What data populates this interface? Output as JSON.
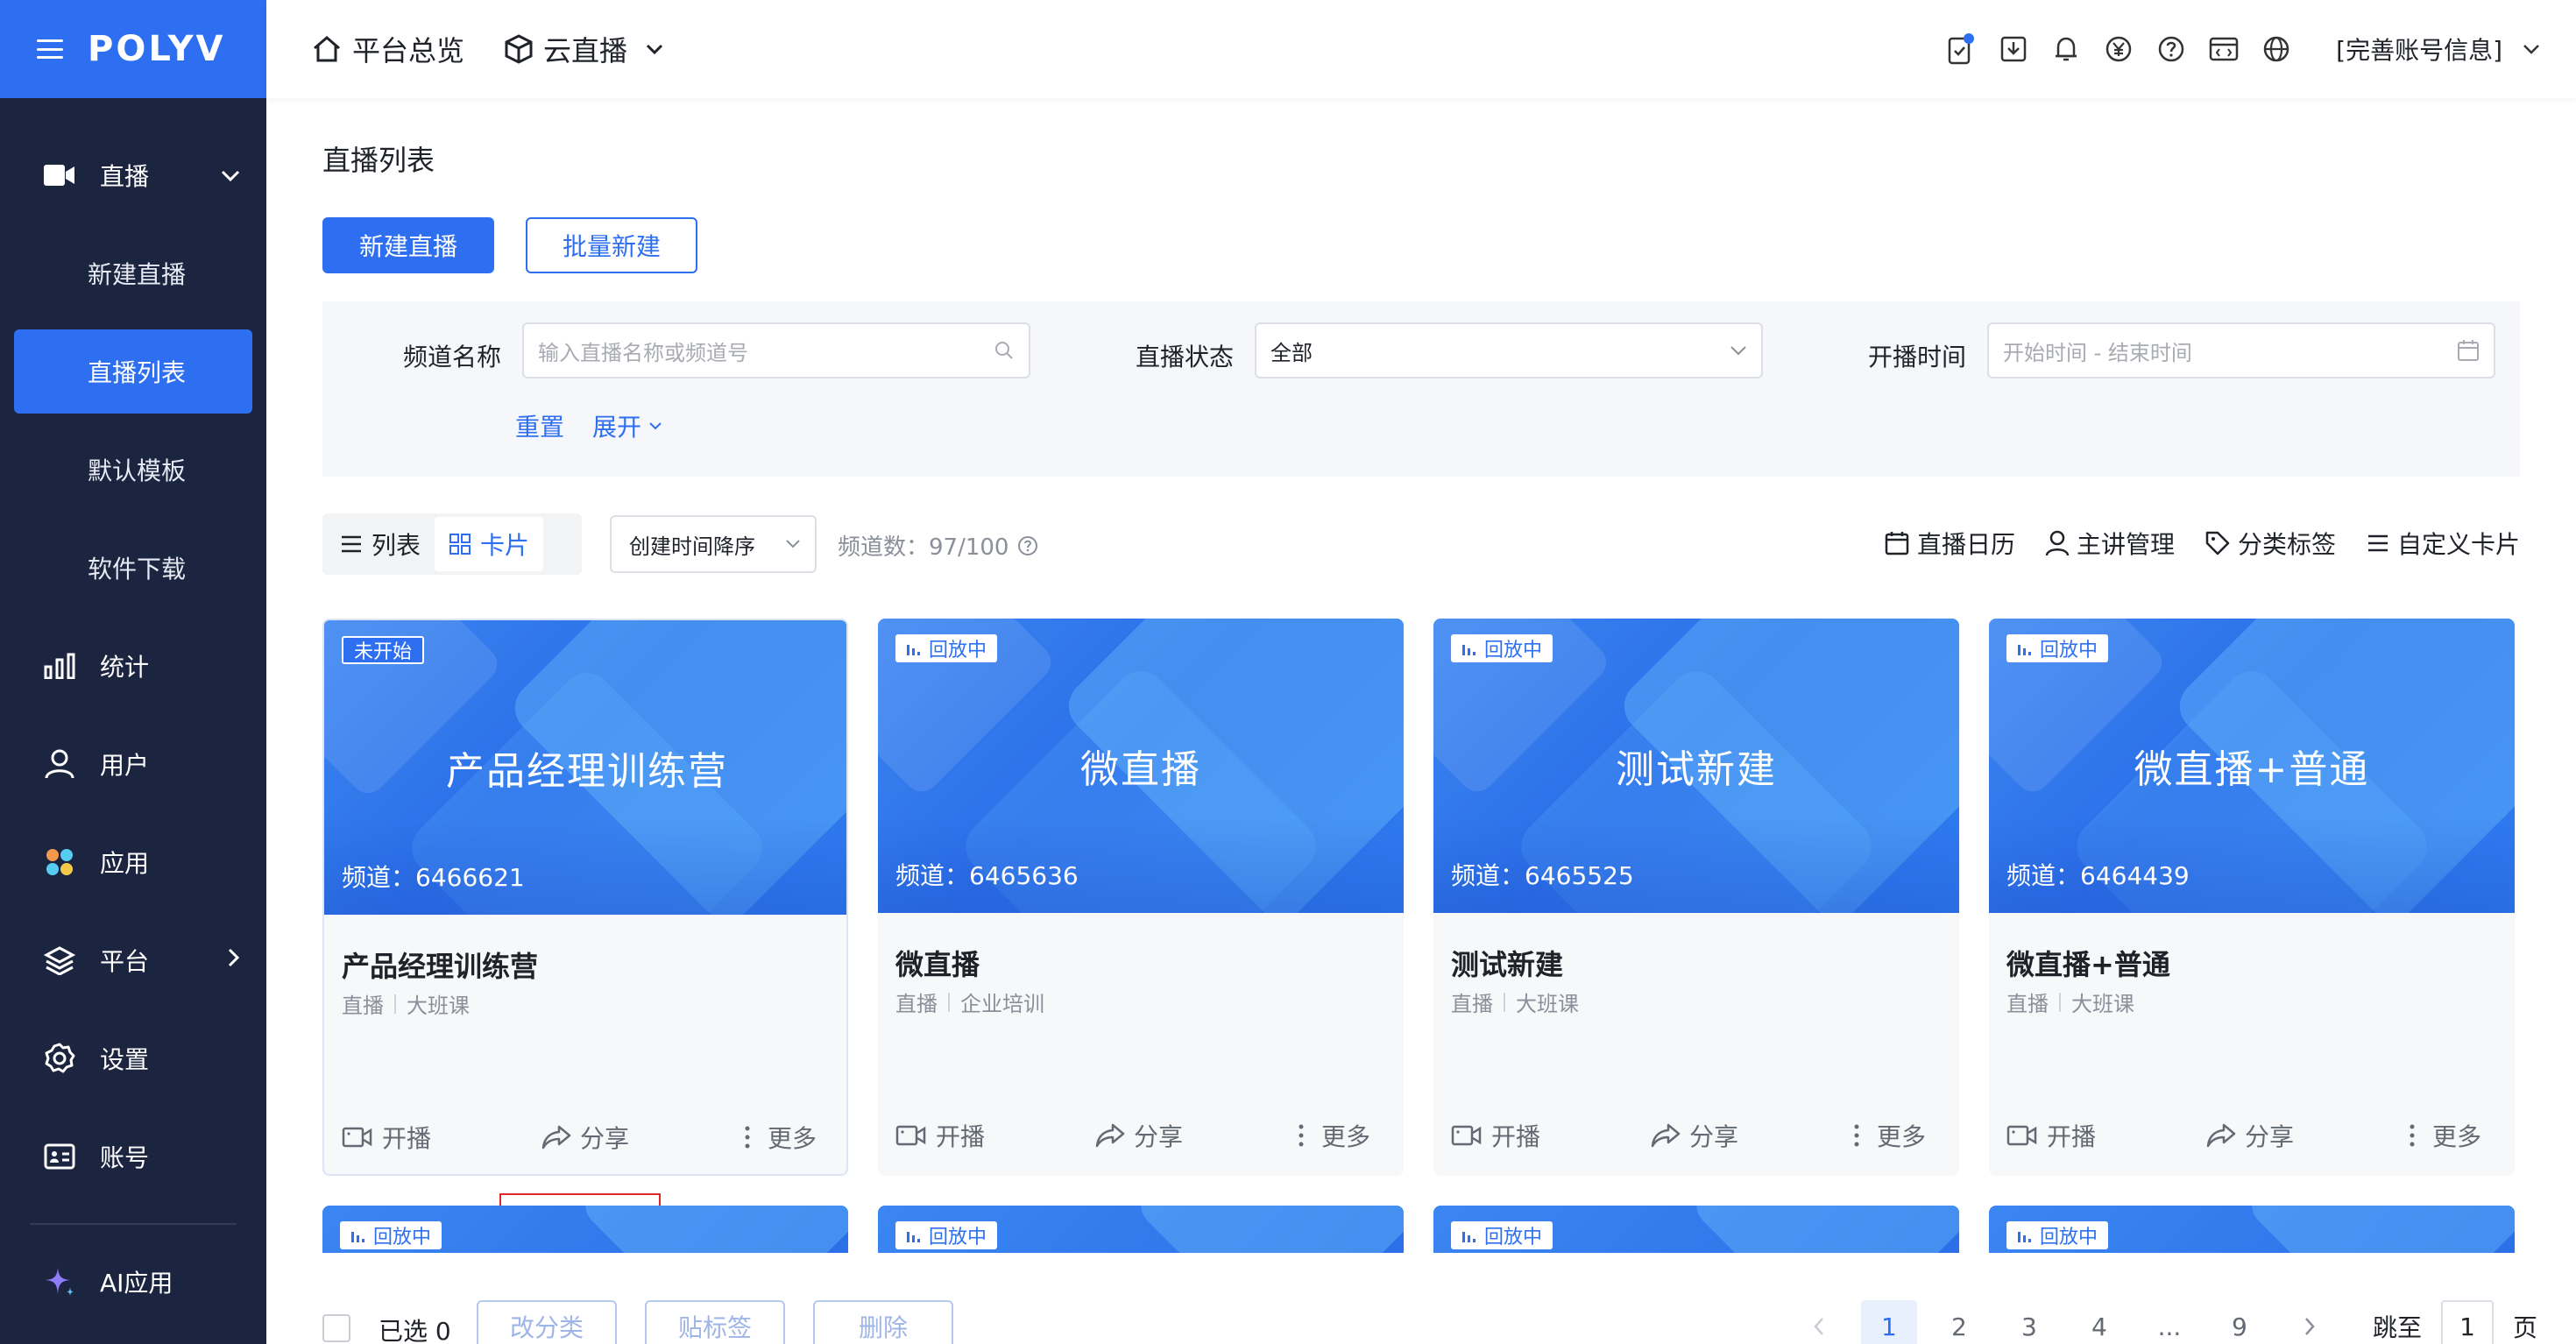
{
  "sidebar": {
    "logo": "POLYV",
    "live_section": "直播",
    "sub_items": [
      "新建直播",
      "直播列表",
      "默认模板",
      "软件下载"
    ],
    "items": [
      "统计",
      "用户",
      "应用",
      "平台",
      "设置",
      "账号"
    ],
    "ai": "AI应用"
  },
  "topbar": {
    "overview": "平台总览",
    "cloud_live": "云直播",
    "account": "[完善账号信息]"
  },
  "page": {
    "title": "直播列表",
    "new_button": "新建直播",
    "batch_button": "批量新建"
  },
  "filter": {
    "channel_label": "频道名称",
    "channel_placeholder": "输入直播名称或频道号",
    "status_label": "直播状态",
    "status_value": "全部",
    "time_label": "开播时间",
    "time_placeholder": "开始时间 - 结束时间",
    "reset": "重置",
    "expand": "展开"
  },
  "toolbar": {
    "view_list": "列表",
    "view_card": "卡片",
    "sort": "创建时间降序",
    "count": "频道数：97/100",
    "calendar": "直播日历",
    "speaker": "主讲管理",
    "tags": "分类标签",
    "custom": "自定义卡片"
  },
  "cards": [
    {
      "status": "未开始",
      "title": "产品经理训练营",
      "channel": "频道：6466621",
      "name": "产品经理训练营",
      "type": "直播",
      "category": "大班课"
    },
    {
      "status": "回放中",
      "title": "微直播",
      "channel": "频道：6465636",
      "name": "微直播",
      "type": "直播",
      "category": "企业培训"
    },
    {
      "status": "回放中",
      "title": "测试新建",
      "channel": "频道：6465525",
      "name": "测试新建",
      "type": "直播",
      "category": "大班课"
    },
    {
      "status": "回放中",
      "title": "微直播+普通",
      "channel": "频道：6464439",
      "name": "微直播+普通",
      "type": "直播",
      "category": "大班课"
    }
  ],
  "card_actions": {
    "start": "开播",
    "share": "分享",
    "more": "更多"
  },
  "row2_status": "回放中",
  "bottom": {
    "selected": "已选 0",
    "change_category": "改分类",
    "add_tag": "贴标签",
    "delete": "删除"
  },
  "pagination": {
    "pages": [
      "1",
      "2",
      "3",
      "4",
      "...",
      "9"
    ],
    "jump": "跳至",
    "jump_value": "1",
    "page_unit": "页"
  },
  "colors": {
    "primary": "#2d6ff0",
    "sidebar": "#1c2540",
    "highlight": "#e0262b"
  }
}
